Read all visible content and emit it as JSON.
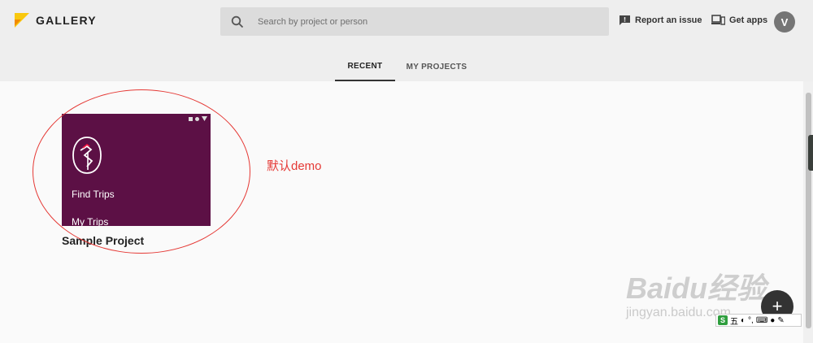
{
  "header": {
    "app_title": "GALLERY",
    "search_placeholder": "Search by project or person",
    "report_label": "Report an issue",
    "get_apps_label": "Get apps",
    "avatar_initial": "V"
  },
  "tabs": [
    {
      "label": "RECENT",
      "active": true
    },
    {
      "label": "MY PROJECTS",
      "active": false
    }
  ],
  "project": {
    "name": "Sample Project",
    "preview_items": [
      "Find Trips",
      "My Trips"
    ]
  },
  "annotation": {
    "text": "默认demo"
  },
  "fab": {
    "label": "+"
  },
  "watermark": {
    "main": "Baidu经验",
    "sub": "jingyan.baidu.com"
  },
  "ime": {
    "s_label": "S",
    "lang": "五"
  },
  "colors": {
    "header_bg": "#eeeeee",
    "card_bg": "#5c1045",
    "logo_yellow": "#f9c80e",
    "annotation_red": "#e53935"
  }
}
